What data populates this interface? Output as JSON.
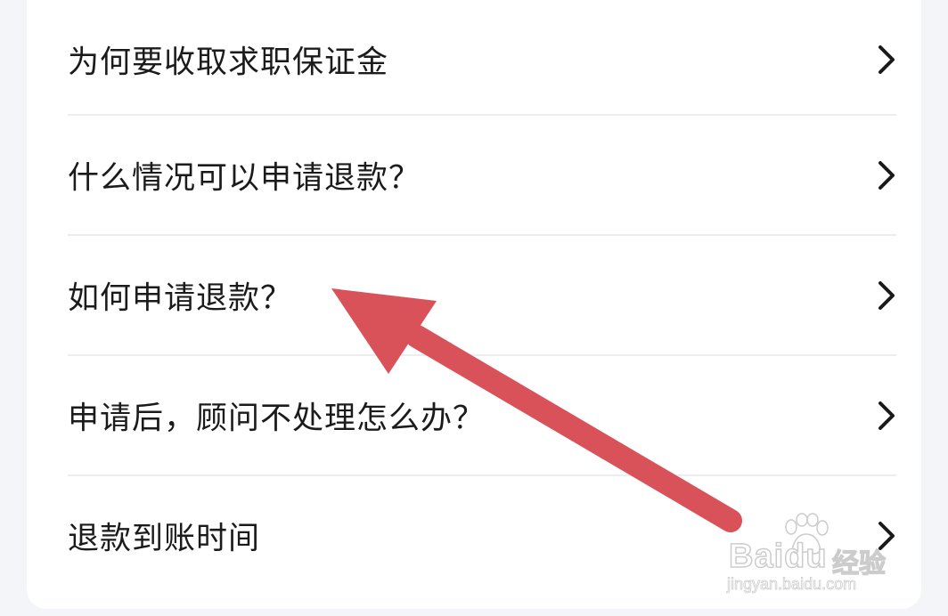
{
  "faq": {
    "items": [
      {
        "label": "为何要收取求职保证金"
      },
      {
        "label": "什么情况可以申请退款？"
      },
      {
        "label": "如何申请退款？"
      },
      {
        "label": "申请后，顾问不处理怎么办？"
      },
      {
        "label": "退款到账时间"
      }
    ],
    "item_icon": "chevron-right-icon"
  },
  "annotation": {
    "arrow_color": "#d9525a"
  },
  "watermark": {
    "logo": "Baidu",
    "sub": "经验",
    "url": "jingyan.baidu.com"
  }
}
